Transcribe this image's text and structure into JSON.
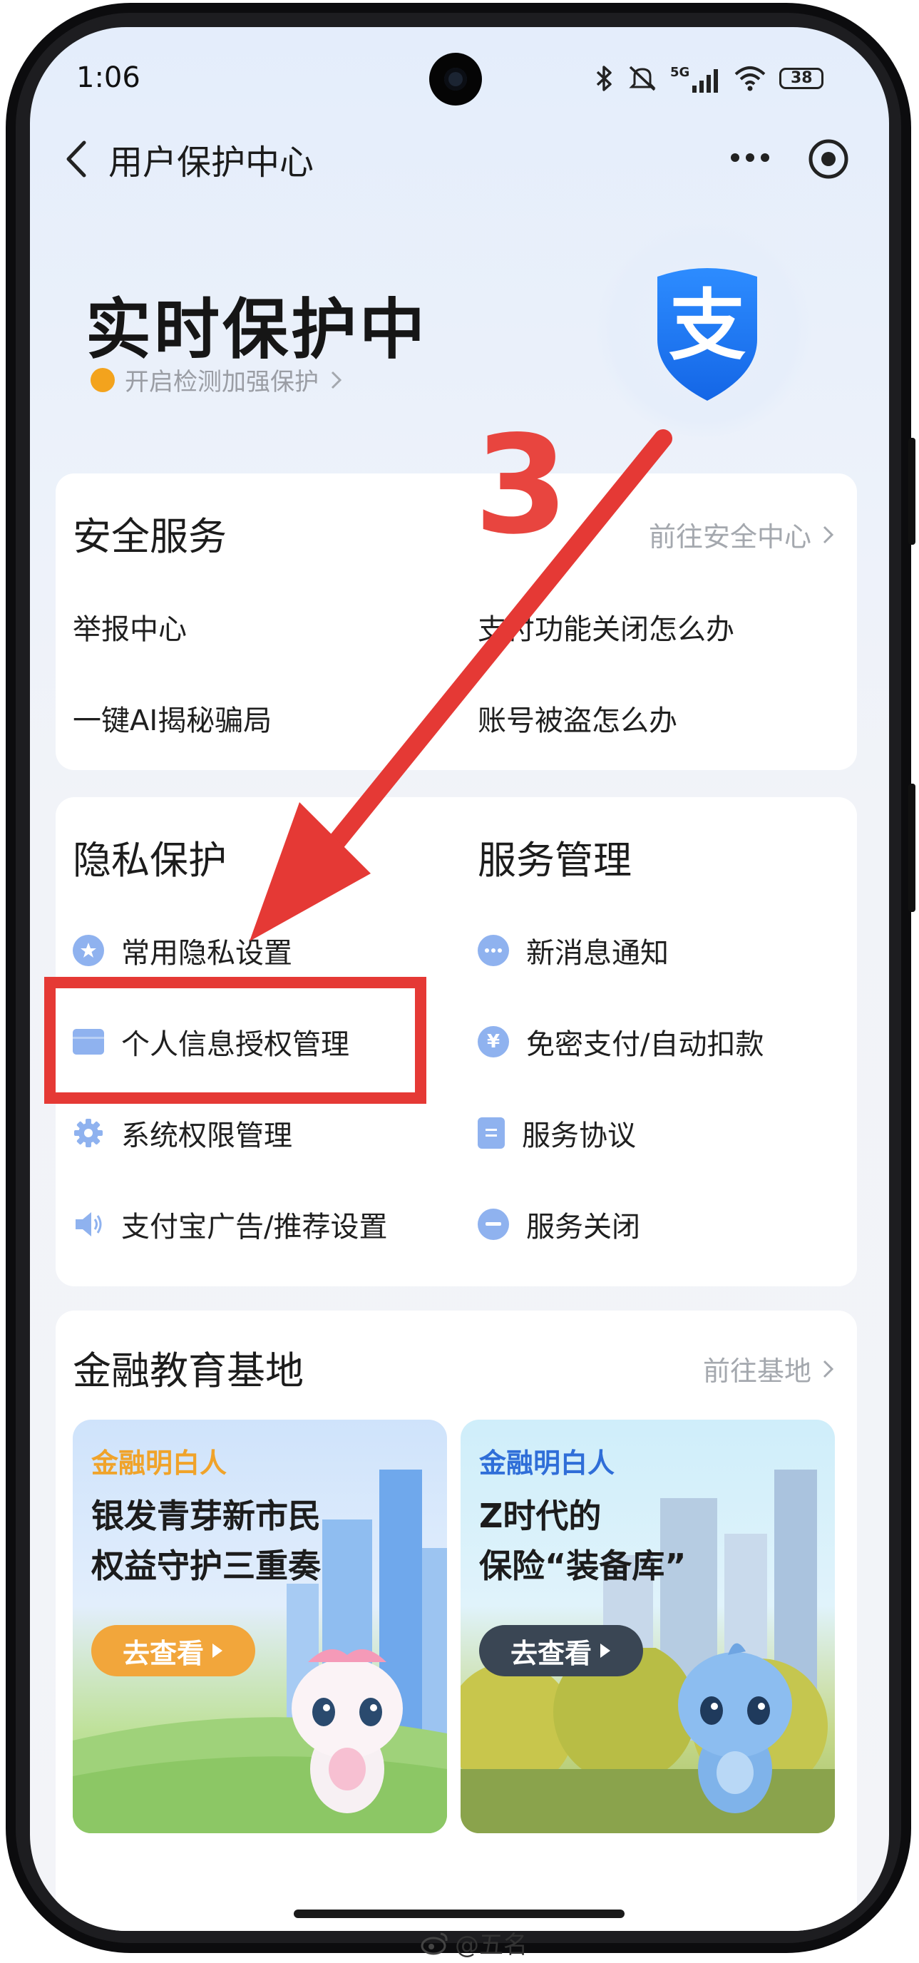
{
  "status_bar": {
    "time": "1:06",
    "network": "5G",
    "battery": "38"
  },
  "nav": {
    "title": "用户保护中心"
  },
  "hero": {
    "title": "实时保护中",
    "subtitle": "开启检测加强保护",
    "logo_char": "支",
    "accent": "#1677ff"
  },
  "security": {
    "title": "安全服务",
    "link": "前往安全中心",
    "items": [
      "举报中心",
      "支付功能关闭怎么办",
      "一键AI揭秘骗局",
      "账号被盗怎么办"
    ]
  },
  "privacy": {
    "title": "隐私保护",
    "items": [
      {
        "label": "常用隐私设置",
        "icon": "star-icon"
      },
      {
        "label": "个人信息授权管理",
        "icon": "folder-icon"
      },
      {
        "label": "系统权限管理",
        "icon": "gear-icon"
      },
      {
        "label": "支付宝广告/推荐设置",
        "icon": "speaker-icon"
      }
    ]
  },
  "service": {
    "title": "服务管理",
    "items": [
      {
        "label": "新消息通知",
        "icon": "message-icon"
      },
      {
        "label": "免密支付/自动扣款",
        "icon": "yuan-icon"
      },
      {
        "label": "服务协议",
        "icon": "document-icon"
      },
      {
        "label": "服务关闭",
        "icon": "minus-icon"
      }
    ]
  },
  "edu": {
    "title": "金融教育基地",
    "link": "前往基地",
    "cards": [
      {
        "tag": "金融明白人",
        "line1": "银发青芽新市民",
        "line2": "权益守护三重奏",
        "button": "去查看",
        "tag_color": "#f0a32a",
        "button_color": "#f2a63b"
      },
      {
        "tag": "金融明白人",
        "line1": "Z时代的",
        "line2": "保险“装备库”",
        "button": "去查看",
        "tag_color": "#2f6ed8",
        "button_color": "#3a4654"
      }
    ]
  },
  "annotation": {
    "step_number": "3",
    "color": "#e53935"
  },
  "watermark": "@五名"
}
